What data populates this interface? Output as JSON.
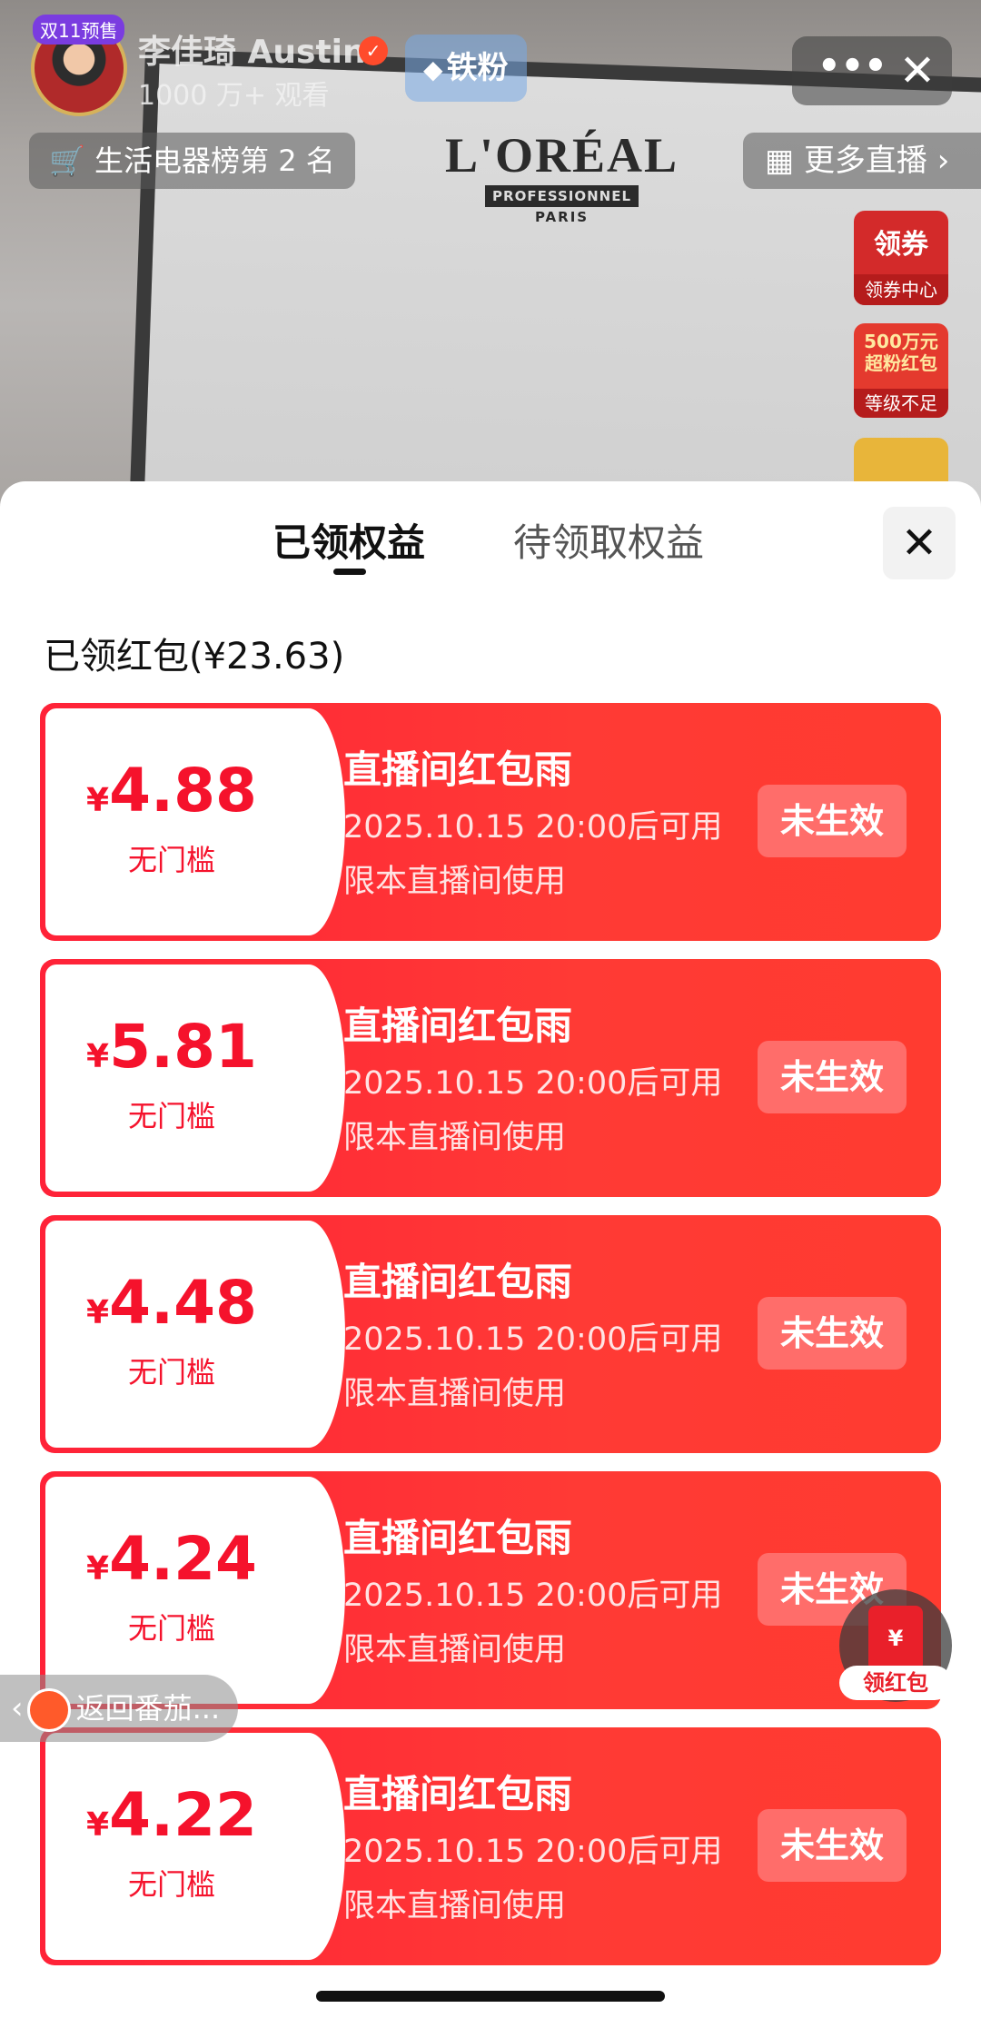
{
  "live": {
    "avatar_badge": "双11预售",
    "host_name": "李佳琦 Austin",
    "verified_icon": "✓",
    "viewer_count": "1000 万+ 观看",
    "fan_button": "铁粉",
    "rank_chip": "生活电器榜第 2 名",
    "more_live": "更多直播",
    "brand": {
      "main": "L'ORÉAL",
      "sub": "PROFESSIONNEL",
      "city": "PARIS"
    },
    "widgets": {
      "coupon_top": "领券",
      "coupon_bottom": "领券中心",
      "bigred_top": "500万元 超粉红包",
      "bigred_bottom": "等级不足"
    }
  },
  "sheet": {
    "tabs": [
      "已领权益",
      "待领取权益"
    ],
    "section_title": "已领红包(¥23.63)",
    "coupons": [
      {
        "currency": "¥",
        "amount": "4.88",
        "threshold": "无门槛",
        "title": "直播间红包雨",
        "date": "2025.10.15 20:00后可用",
        "limit": "限本直播间使用",
        "status": "未生效"
      },
      {
        "currency": "¥",
        "amount": "5.81",
        "threshold": "无门槛",
        "title": "直播间红包雨",
        "date": "2025.10.15 20:00后可用",
        "limit": "限本直播间使用",
        "status": "未生效"
      },
      {
        "currency": "¥",
        "amount": "4.48",
        "threshold": "无门槛",
        "title": "直播间红包雨",
        "date": "2025.10.15 20:00后可用",
        "limit": "限本直播间使用",
        "status": "未生效"
      },
      {
        "currency": "¥",
        "amount": "4.24",
        "threshold": "无门槛",
        "title": "直播间红包雨",
        "date": "2025.10.15 20:00后可用",
        "limit": "限本直播间使用",
        "status": "未生效"
      },
      {
        "currency": "¥",
        "amount": "4.22",
        "threshold": "无门槛",
        "title": "直播间红包雨",
        "date": "2025.10.15 20:00后可用",
        "limit": "限本直播间使用",
        "status": "未生效"
      }
    ]
  },
  "floating": {
    "back_label": "返回番茄...",
    "redpack_icon": "¥",
    "redpack_label": "领红包"
  },
  "colors": {
    "accent": "#ff2238",
    "amount": "#f5122c",
    "status_bg": "#ff6d6a"
  }
}
